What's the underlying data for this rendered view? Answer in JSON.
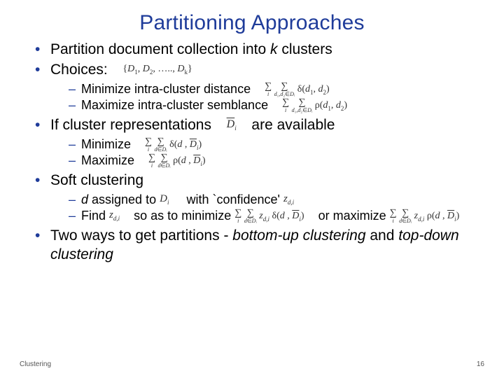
{
  "title": "Partitioning Approaches",
  "b1_a": "Partition document collection into ",
  "b1_k": "k",
  "b1_b": " clusters",
  "b2": "Choices:",
  "b2_math": "{D₁, D₂, …, D_k}",
  "b2s1": "Minimize intra-cluster distance",
  "b2s1_math": "Σᵢ Σ_{d₁,d₂∈Dᵢ} δ(d₁, d₂)",
  "b2s2": "Maximize intra-cluster semblance",
  "b2s2_math": "Σᵢ Σ_{d₁,d₂∈Dᵢ} ρ(d₁, d₂)",
  "b3_a": "If cluster representations",
  "b3_math": "D̄ᵢ",
  "b3_b": "are available",
  "b3s1": "Minimize",
  "b3s1_math": "Σᵢ Σ_{d∈Dᵢ} δ(d, D̄ᵢ)",
  "b3s2": "Maximize",
  "b3s2_math": "Σᵢ Σ_{d∈Dᵢ} ρ(d, D̄ᵢ)",
  "b4": "Soft clustering",
  "b4s1_a": "d",
  "b4s1_b": " assigned to ",
  "b4s1_m1": "Dᵢ",
  "b4s1_c": " with `confidence' ",
  "b4s1_m2": "z_{d,i}",
  "b4s2_a": "Find ",
  "b4s2_m1": "z_{d,i}",
  "b4s2_b": " so as to minimize ",
  "b4s2_m2": "Σᵢ Σ_{d∈Dᵢ} z_{d,i} δ(d, D̄ᵢ)",
  "b4s2_c": " or maximize ",
  "b4s2_m3": "Σᵢ Σ_{d∈Dᵢ} z_{d,i} ρ(d, D̄ᵢ)",
  "b5_a": " Two ways to get partitions - ",
  "b5_b": "bottom-up clustering",
  "b5_c": " and ",
  "b5_d": "top-down clustering",
  "footer_left": "Clustering",
  "footer_right": "16"
}
